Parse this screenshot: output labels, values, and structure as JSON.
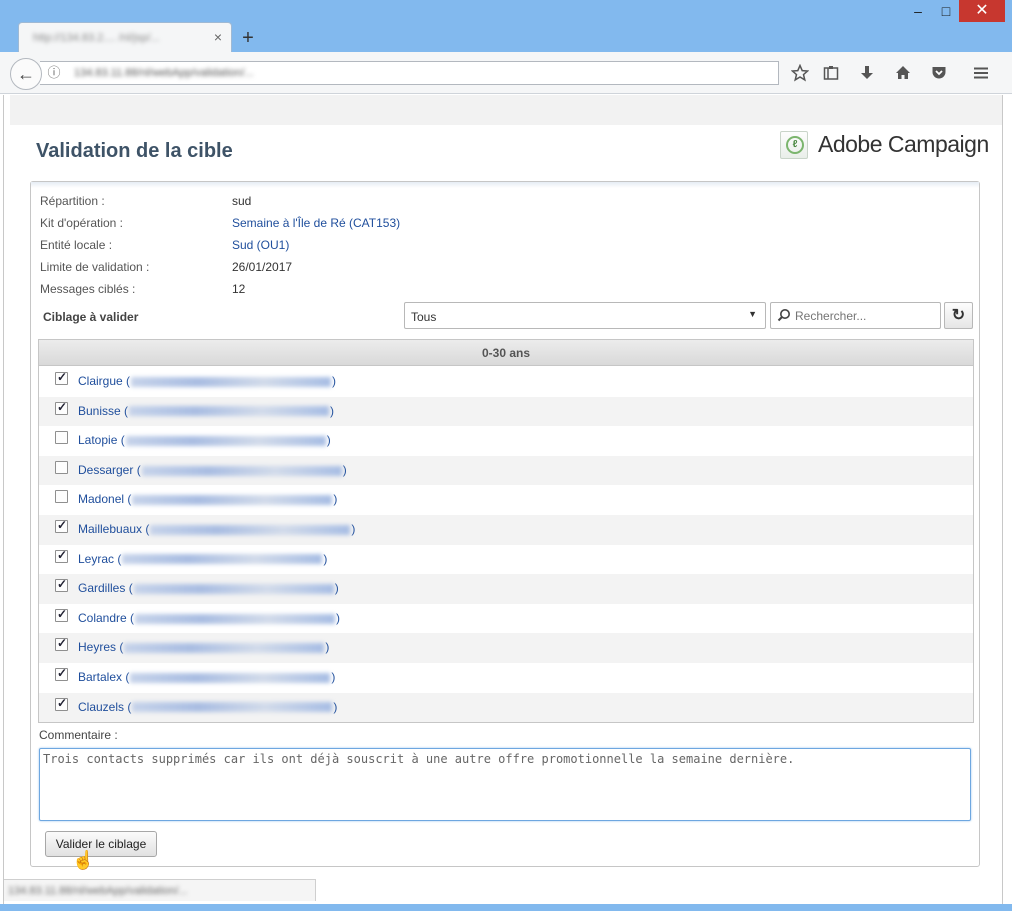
{
  "browser": {
    "tab_title": "http://134.83.2.... /nl/jsp/... ",
    "tab_close": "×",
    "new_tab": "+",
    "minimize": "–",
    "maximize": "□",
    "close": "✕",
    "back": "←",
    "info": "ⓘ",
    "url": "134.83.11.88/nl/webApp/validation/...",
    "toolbar_icons": [
      "bookmark-star-icon",
      "reading-list-icon",
      "download-icon",
      "home-icon",
      "pocket-icon",
      "menu-icon"
    ],
    "status_text": "134.83.11.88/nl/webApp/validation/..."
  },
  "header": {
    "title": "Validation de la cible",
    "brand": "Adobe Campaign"
  },
  "details": [
    {
      "label": "Répartition :",
      "value": "sud",
      "link": false
    },
    {
      "label": "Kit d'opération :",
      "value": "Semaine à l'Île de Ré (CAT153)",
      "link": true
    },
    {
      "label": "Entité locale :",
      "value": "Sud (OU1)",
      "link": true
    },
    {
      "label": "Limite de validation :",
      "value": "26/01/2017",
      "link": false
    },
    {
      "label": "Messages ciblés :",
      "value": "12",
      "link": false
    }
  ],
  "targeting": {
    "title": "Ciblage à valider",
    "filter_value": "Tous",
    "search_placeholder": "Rechercher...",
    "group_header": "0-30 ans",
    "rows": [
      {
        "name": "Clairgue",
        "checked": true
      },
      {
        "name": "Bunisse",
        "checked": true
      },
      {
        "name": "Latopie",
        "checked": false
      },
      {
        "name": "Dessarger",
        "checked": false
      },
      {
        "name": "Madonel",
        "checked": false
      },
      {
        "name": "Maillebuaux",
        "checked": true
      },
      {
        "name": "Leyrac",
        "checked": true
      },
      {
        "name": "Gardilles",
        "checked": true
      },
      {
        "name": "Colandre",
        "checked": true
      },
      {
        "name": "Heyres",
        "checked": true
      },
      {
        "name": "Bartalex",
        "checked": true
      },
      {
        "name": "Clauzels",
        "checked": true
      }
    ]
  },
  "comment": {
    "label": "Commentaire :",
    "value": "Trois contacts supprimés car ils ont déjà souscrit à une autre offre promotionnelle la semaine dernière."
  },
  "actions": {
    "submit_label": "Valider le ciblage"
  },
  "colors": {
    "titlebar": "#82b9ee",
    "link": "#1f4e9c",
    "page_title": "#3e5367",
    "close_button": "#c7372f"
  }
}
